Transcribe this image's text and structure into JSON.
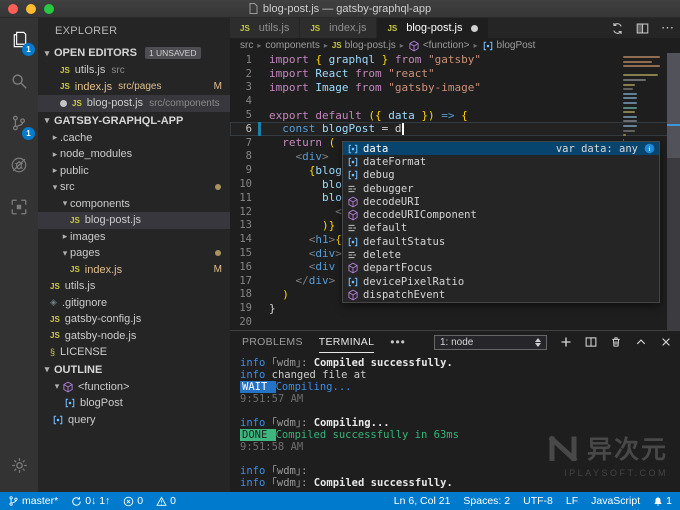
{
  "window": {
    "title": "blog-post.js — gatsby-graphql-app"
  },
  "activity_bar": {
    "items": [
      {
        "name": "explorer",
        "badge": "1",
        "active": true
      },
      {
        "name": "search",
        "badge": "",
        "active": false
      },
      {
        "name": "source-control",
        "badge": "1",
        "active": false
      },
      {
        "name": "debug",
        "badge": "",
        "active": false
      },
      {
        "name": "extensions",
        "badge": "",
        "active": false
      }
    ],
    "settings": {
      "name": "settings"
    }
  },
  "sidebar": {
    "title": "EXPLORER",
    "open_editors": {
      "label": "OPEN EDITORS",
      "badge": "1 UNSAVED",
      "items": [
        {
          "icon": "js",
          "name": "utils.js",
          "desc": "src",
          "badge": "",
          "modified": false,
          "dirty": false,
          "selected": false
        },
        {
          "icon": "js",
          "name": "index.js",
          "desc": "src/pages",
          "badge": "M",
          "modified": true,
          "dirty": false,
          "selected": false
        },
        {
          "icon": "js",
          "name": "blog-post.js",
          "desc": "src/components",
          "badge": "",
          "modified": false,
          "dirty": true,
          "selected": true
        }
      ]
    },
    "project": {
      "label": "GATSBY-GRAPHQL-APP",
      "items": [
        {
          "level": 0,
          "kind": "folder",
          "expanded": false,
          "name": ".cache"
        },
        {
          "level": 0,
          "kind": "folder",
          "expanded": false,
          "name": "node_modules"
        },
        {
          "level": 0,
          "kind": "folder",
          "expanded": false,
          "name": "public"
        },
        {
          "level": 0,
          "kind": "folder",
          "expanded": true,
          "name": "src",
          "dot": true
        },
        {
          "level": 1,
          "kind": "folder",
          "expanded": true,
          "name": "components"
        },
        {
          "level": 2,
          "kind": "file",
          "icon": "js",
          "name": "blog-post.js",
          "selected": true
        },
        {
          "level": 1,
          "kind": "folder",
          "expanded": false,
          "name": "images"
        },
        {
          "level": 1,
          "kind": "folder",
          "expanded": true,
          "name": "pages",
          "dot": true
        },
        {
          "level": 2,
          "kind": "file",
          "icon": "js",
          "name": "index.js",
          "badge": "M",
          "modified": true
        },
        {
          "level": 0,
          "kind": "file",
          "icon": "js",
          "name": "utils.js"
        },
        {
          "level": 0,
          "kind": "file",
          "icon": "gitignore",
          "name": ".gitignore"
        },
        {
          "level": 0,
          "kind": "file",
          "icon": "js",
          "name": "gatsby-config.js"
        },
        {
          "level": 0,
          "kind": "file",
          "icon": "js",
          "name": "gatsby-node.js"
        },
        {
          "level": 0,
          "kind": "file",
          "icon": "license",
          "name": "LICENSE"
        }
      ]
    },
    "outline": {
      "label": "OUTLINE",
      "items": [
        {
          "level": 0,
          "expanded": true,
          "icon": "method",
          "name": "<function>"
        },
        {
          "level": 1,
          "icon": "var",
          "name": "blogPost"
        },
        {
          "level": 0,
          "icon": "var",
          "name": "query"
        }
      ]
    }
  },
  "tabs": [
    {
      "icon": "js",
      "label": "utils.js",
      "active": false,
      "dirty": false
    },
    {
      "icon": "js",
      "label": "index.js",
      "active": false,
      "dirty": false
    },
    {
      "icon": "js",
      "label": "blog-post.js",
      "active": true,
      "dirty": true
    }
  ],
  "breadcrumb": [
    {
      "label": "src"
    },
    {
      "label": "components"
    },
    {
      "label": "blog-post.js",
      "icon": "js"
    },
    {
      "label": "<function>",
      "icon": "method"
    },
    {
      "label": "blogPost",
      "icon": "var"
    }
  ],
  "editor": {
    "cursor_line": 6,
    "lines": [
      {
        "n": 1,
        "tokens": [
          {
            "t": "import",
            "c": "kw"
          },
          {
            "t": " ",
            "c": "df"
          },
          {
            "t": "{ ",
            "c": "au"
          },
          {
            "t": "graphql",
            "c": "var"
          },
          {
            "t": " }",
            "c": "au"
          },
          {
            "t": " ",
            "c": "df"
          },
          {
            "t": "from",
            "c": "kw"
          },
          {
            "t": " ",
            "c": "df"
          },
          {
            "t": "\"gatsby\"",
            "c": "str"
          }
        ]
      },
      {
        "n": 2,
        "tokens": [
          {
            "t": "import",
            "c": "kw"
          },
          {
            "t": " ",
            "c": "df"
          },
          {
            "t": "React",
            "c": "var"
          },
          {
            "t": " ",
            "c": "df"
          },
          {
            "t": "from",
            "c": "kw"
          },
          {
            "t": " ",
            "c": "df"
          },
          {
            "t": "\"react\"",
            "c": "str"
          }
        ]
      },
      {
        "n": 3,
        "tokens": [
          {
            "t": "import",
            "c": "kw"
          },
          {
            "t": " ",
            "c": "df"
          },
          {
            "t": "Image",
            "c": "var"
          },
          {
            "t": " ",
            "c": "df"
          },
          {
            "t": "from",
            "c": "kw"
          },
          {
            "t": " ",
            "c": "df"
          },
          {
            "t": "\"gatsby-image\"",
            "c": "str"
          }
        ]
      },
      {
        "n": 4,
        "tokens": []
      },
      {
        "n": 5,
        "tokens": [
          {
            "t": "export",
            "c": "kw"
          },
          {
            "t": " ",
            "c": "df"
          },
          {
            "t": "default",
            "c": "kw"
          },
          {
            "t": " ",
            "c": "df"
          },
          {
            "t": "({ ",
            "c": "au"
          },
          {
            "t": "data",
            "c": "var"
          },
          {
            "t": " })",
            "c": "au"
          },
          {
            "t": " ",
            "c": "df"
          },
          {
            "t": "=>",
            "c": "kb"
          },
          {
            "t": " {",
            "c": "au"
          }
        ]
      },
      {
        "n": 6,
        "tokens": [
          {
            "t": "  ",
            "c": "df"
          },
          {
            "t": "const",
            "c": "kb"
          },
          {
            "t": " ",
            "c": "df"
          },
          {
            "t": "blogPost",
            "c": "var"
          },
          {
            "t": " = ",
            "c": "df"
          },
          {
            "t": "d",
            "c": "df"
          }
        ],
        "cursor": true
      },
      {
        "n": 7,
        "tokens": [
          {
            "t": "  ",
            "c": "df"
          },
          {
            "t": "return",
            "c": "kw"
          },
          {
            "t": " ",
            "c": "df"
          },
          {
            "t": "(",
            "c": "au"
          }
        ]
      },
      {
        "n": 8,
        "tokens": [
          {
            "t": "    ",
            "c": "df"
          },
          {
            "t": "<",
            "c": "tb"
          },
          {
            "t": "div",
            "c": "tag"
          },
          {
            "t": ">",
            "c": "tb"
          }
        ]
      },
      {
        "n": 9,
        "tokens": [
          {
            "t": "      ",
            "c": "df"
          },
          {
            "t": "{",
            "c": "au"
          },
          {
            "t": "blogP",
            "c": "var"
          }
        ]
      },
      {
        "n": 10,
        "tokens": [
          {
            "t": "        ",
            "c": "df"
          },
          {
            "t": "blog",
            "c": "var"
          }
        ]
      },
      {
        "n": 11,
        "tokens": [
          {
            "t": "        ",
            "c": "df"
          },
          {
            "t": "blog",
            "c": "var"
          }
        ]
      },
      {
        "n": 12,
        "tokens": [
          {
            "t": "          ",
            "c": "df"
          },
          {
            "t": "<",
            "c": "tb"
          },
          {
            "t": "I",
            "c": "cmp"
          }
        ]
      },
      {
        "n": 13,
        "tokens": [
          {
            "t": "        ",
            "c": "df"
          },
          {
            "t": ")}",
            "c": "au"
          }
        ]
      },
      {
        "n": 14,
        "tokens": [
          {
            "t": "      ",
            "c": "df"
          },
          {
            "t": "<",
            "c": "tb"
          },
          {
            "t": "h1",
            "c": "tag"
          },
          {
            "t": ">",
            "c": "tb"
          },
          {
            "t": "{",
            "c": "au"
          },
          {
            "t": "b",
            "c": "var"
          }
        ]
      },
      {
        "n": 15,
        "tokens": [
          {
            "t": "      ",
            "c": "df"
          },
          {
            "t": "<",
            "c": "tb"
          },
          {
            "t": "div",
            "c": "tag"
          },
          {
            "t": ">",
            "c": "tb"
          },
          {
            "t": "P",
            "c": "pl"
          }
        ]
      },
      {
        "n": 16,
        "tokens": [
          {
            "t": "      ",
            "c": "df"
          },
          {
            "t": "<",
            "c": "tb"
          },
          {
            "t": "div",
            "c": "tag"
          },
          {
            "t": " ",
            "c": "df"
          },
          {
            "t": "d",
            "c": "var"
          }
        ]
      },
      {
        "n": 17,
        "tokens": [
          {
            "t": "    ",
            "c": "df"
          },
          {
            "t": "</",
            "c": "tb"
          },
          {
            "t": "div",
            "c": "tag"
          },
          {
            "t": ">",
            "c": "tb"
          }
        ]
      },
      {
        "n": 18,
        "tokens": [
          {
            "t": "  ",
            "c": "df"
          },
          {
            "t": ")",
            "c": "au"
          }
        ]
      },
      {
        "n": 19,
        "tokens": [
          {
            "t": "}",
            "c": "df"
          }
        ]
      },
      {
        "n": 20,
        "tokens": []
      }
    ]
  },
  "autocomplete": {
    "items": [
      {
        "icon": "var",
        "label": "data",
        "selected": true,
        "detail": "var data: any"
      },
      {
        "icon": "var",
        "label": "dateFormat"
      },
      {
        "icon": "var",
        "label": "debug"
      },
      {
        "icon": "keyword",
        "label": "debugger"
      },
      {
        "icon": "method",
        "label": "decodeURI"
      },
      {
        "icon": "method",
        "label": "decodeURIComponent"
      },
      {
        "icon": "keyword",
        "label": "default"
      },
      {
        "icon": "var",
        "label": "defaultStatus"
      },
      {
        "icon": "keyword",
        "label": "delete"
      },
      {
        "icon": "method",
        "label": "departFocus"
      },
      {
        "icon": "var",
        "label": "devicePixelRatio"
      },
      {
        "icon": "method",
        "label": "dispatchEvent"
      }
    ]
  },
  "panel": {
    "tabs": [
      {
        "label": "PROBLEMS",
        "active": false
      },
      {
        "label": "TERMINAL",
        "active": true
      }
    ],
    "more_label": "•••",
    "dropdown_value": "1: node",
    "terminal_lines": [
      [
        {
          "t": "info",
          "c": "info"
        },
        {
          "t": " ｢wdm｣: ",
          "c": "dim"
        },
        {
          "t": "Compiled successfully.",
          "c": "txt"
        }
      ],
      [
        {
          "t": "info",
          "c": "info"
        },
        {
          "t": " changed file at",
          "c": "plain"
        }
      ],
      [
        {
          "t": " WAIT ",
          "c": "b-wait"
        },
        {
          "t": " ",
          "c": "plain"
        },
        {
          "t": "Compiling...",
          "c": "blue"
        }
      ],
      [
        {
          "t": "9:51:57 AM",
          "c": "time"
        }
      ],
      [],
      [
        {
          "t": "info",
          "c": "info"
        },
        {
          "t": " ｢wdm｣: ",
          "c": "dim"
        },
        {
          "t": "Compiling...",
          "c": "txt"
        }
      ],
      [
        {
          "t": " DONE ",
          "c": "b-done"
        },
        {
          "t": " ",
          "c": "plain"
        },
        {
          "t": "Compiled successfully in 63ms",
          "c": "green"
        }
      ],
      [
        {
          "t": "9:51:58 AM",
          "c": "time"
        }
      ],
      [],
      [
        {
          "t": "info",
          "c": "info"
        },
        {
          "t": " ｢wdm｣: ",
          "c": "dim"
        }
      ],
      [
        {
          "t": "info",
          "c": "info"
        },
        {
          "t": " ｢wdm｣: ",
          "c": "dim"
        },
        {
          "t": "Compiled successfully.",
          "c": "txt"
        }
      ]
    ]
  },
  "status_bar": {
    "left": [
      {
        "icon": "branch",
        "label": "master*"
      },
      {
        "icon": "sync",
        "label": "0↓ 1↑"
      },
      {
        "icon": "error",
        "label": "0"
      },
      {
        "icon": "warning",
        "label": "0"
      }
    ],
    "right": [
      {
        "label": "Ln 6, Col 21"
      },
      {
        "label": "Spaces: 2"
      },
      {
        "label": "UTF-8"
      },
      {
        "label": "LF"
      },
      {
        "label": "JavaScript"
      },
      {
        "icon": "bell",
        "label": "1"
      }
    ]
  },
  "watermark": {
    "brand": "异次元",
    "site": "IPLAYSOFT.COM"
  },
  "colors": {
    "accent": "#007acc",
    "modified": "#e2c08d",
    "badge": "#007acc",
    "wait": "#2572c7",
    "done": "#3fb57f"
  }
}
